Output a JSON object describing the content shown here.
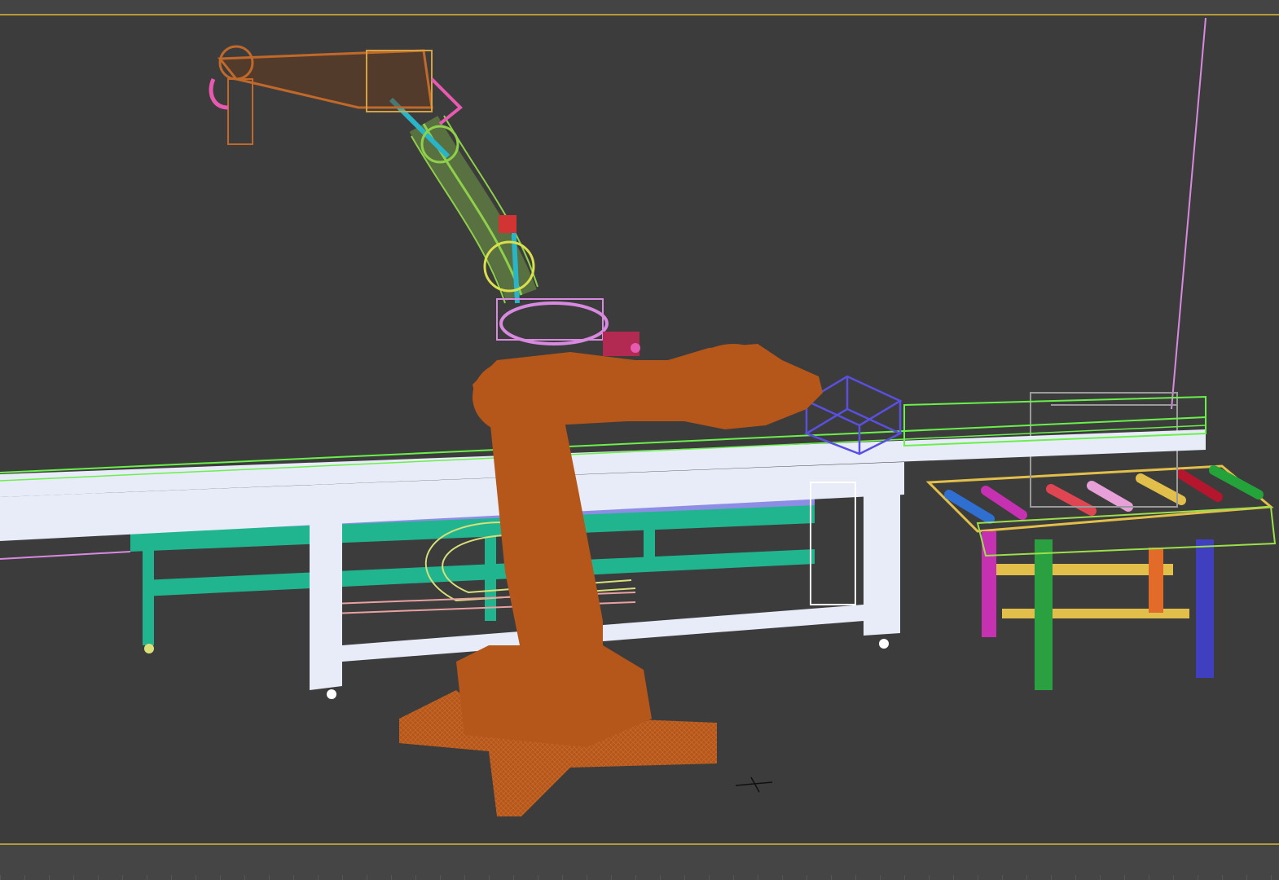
{
  "app": {
    "viewport_label": "",
    "colors": {
      "background": "#3c3c3c",
      "active_border": "#b59a3a",
      "robot_solid": "#b5561a",
      "robot_wire": "#c0692a",
      "conveyor_frame": "#e8ecf8",
      "table_frame": "#21b58f",
      "cable_chain": "#d9e07a",
      "light_line": "#d78adf",
      "target_box": "#5a50e0",
      "output_table": "#e2bf4a"
    }
  },
  "scene": {
    "objects": [
      "industrial-robot-solid",
      "industrial-robot-wireframe-pose",
      "linear-conveyor",
      "support-table",
      "cable-chain",
      "roller-output-table",
      "target-box-gizmo",
      "light-line"
    ]
  }
}
